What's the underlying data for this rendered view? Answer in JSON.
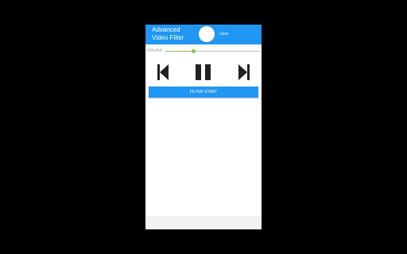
{
  "appbar": {
    "title": "Advanced Video Filter",
    "user_label": "User",
    "color": "#2196f3"
  },
  "volume": {
    "label": "Volume",
    "level": 0.3,
    "color": "#8bc34a"
  },
  "controls": {
    "previous_icon": "skip-previous-icon",
    "pause_icon": "pause-icon",
    "next_icon": "skip-next-icon"
  },
  "filter_button": {
    "label": "FILTER START"
  }
}
